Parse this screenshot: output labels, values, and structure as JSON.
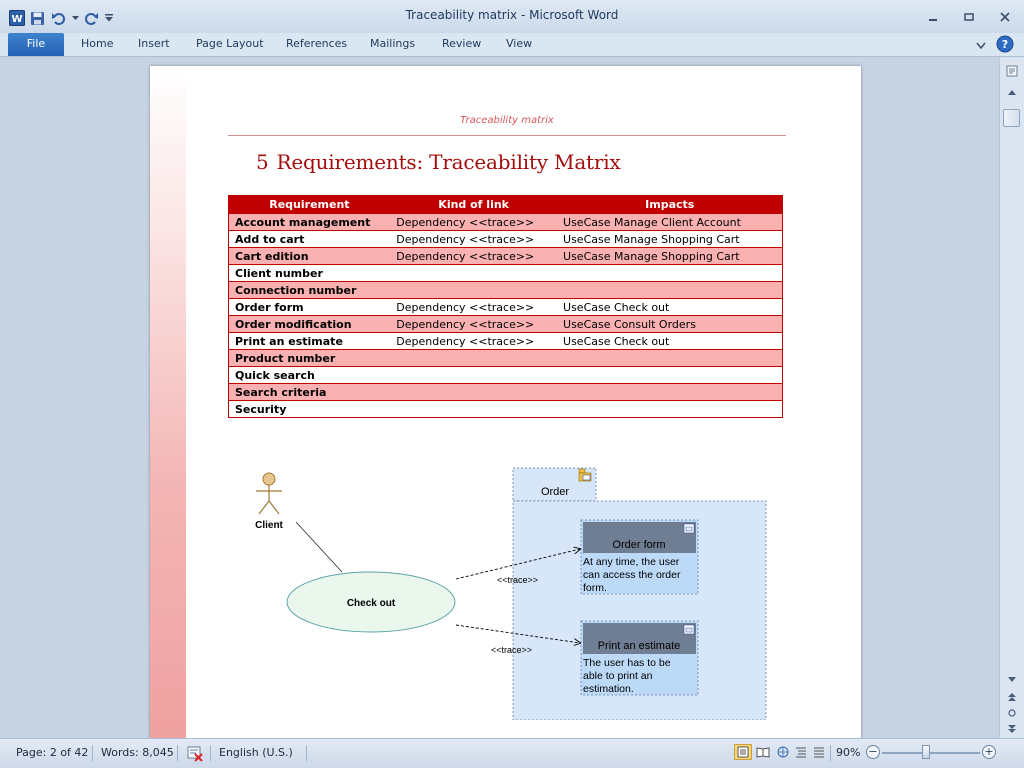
{
  "window": {
    "title": "Traceability matrix  -  Microsoft Word",
    "minimize_icon": "minimize-icon",
    "maximize_icon": "restore-icon",
    "close_icon": "close-icon"
  },
  "ribbon": {
    "tabs": [
      "File",
      "Home",
      "Insert",
      "Page Layout",
      "References",
      "Mailings",
      "Review",
      "View"
    ]
  },
  "document": {
    "running_header": "Traceability matrix",
    "heading_number": "5",
    "heading_text": "Requirements: Traceability Matrix",
    "table": {
      "headers": [
        "Requirement",
        "Kind of link",
        "Impacts"
      ],
      "rows": [
        [
          "Account management",
          "Dependency <<trace>>",
          "UseCase Manage Client Account"
        ],
        [
          "Add to cart",
          "Dependency <<trace>>",
          "UseCase Manage Shopping Cart"
        ],
        [
          "Cart edition",
          "Dependency <<trace>>",
          "UseCase Manage Shopping Cart"
        ],
        [
          "Client number",
          "",
          ""
        ],
        [
          "Connection number",
          "",
          ""
        ],
        [
          "Order form",
          "Dependency <<trace>>",
          "UseCase Check out"
        ],
        [
          "Order modification",
          "Dependency <<trace>>",
          "UseCase Consult Orders"
        ],
        [
          "Print an estimate",
          "Dependency <<trace>>",
          "UseCase Check out"
        ],
        [
          "Product number",
          "",
          ""
        ],
        [
          "Quick search",
          "",
          ""
        ],
        [
          "Search criteria",
          "",
          ""
        ],
        [
          "Security",
          "",
          ""
        ]
      ]
    },
    "diagram": {
      "actor": "Client",
      "use_case": "Check out",
      "package": "Order",
      "req1_title": "Order form",
      "req1_lines": [
        "At any time, the user",
        "can access the order",
        "form."
      ],
      "req2_title": "Print an estimate",
      "req2_lines": [
        "The user has to be",
        "able to print an",
        "estimation."
      ],
      "trace_label": "<<trace>>"
    }
  },
  "status": {
    "page": "Page: 2 of 42",
    "words": "Words: 8,045",
    "language": "English (U.S.)",
    "zoom": "90%"
  },
  "colors": {
    "accent_red": "#c00000",
    "row_alt": "#f9b1b1",
    "heading": "#a50d0d",
    "file_tab": "#2a66b8"
  }
}
